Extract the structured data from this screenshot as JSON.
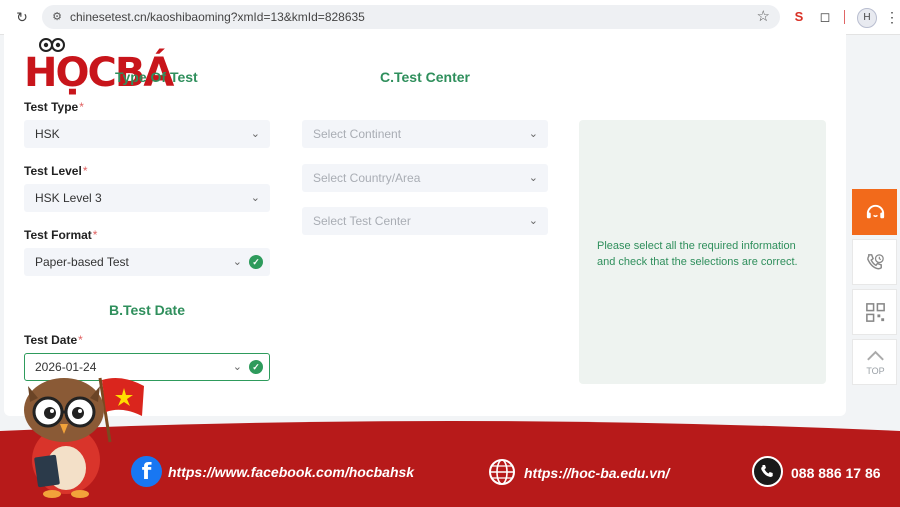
{
  "browser": {
    "url": "chinesetest.cn/kaoshibaoming?xmId=13&kmId=828635",
    "profile_initial": "H"
  },
  "logo": {
    "text": "HỌCBÁ"
  },
  "section_a": {
    "title": "Type Of Test",
    "test_type": {
      "label": "Test Type",
      "value": "HSK"
    },
    "test_level": {
      "label": "Test Level",
      "value": "HSK Level 3"
    },
    "test_format": {
      "label": "Test Format",
      "value": "Paper-based Test"
    }
  },
  "section_b": {
    "title": "B.Test Date",
    "test_date": {
      "label": "Test Date",
      "value": "2026-01-24"
    }
  },
  "section_c": {
    "title": "C.Test Center",
    "continent_placeholder": "Select Continent",
    "country_placeholder": "Select Country/Area",
    "center_placeholder": "Select Test Center",
    "info_message": "Please select all the required information and check that the selections are correct."
  },
  "required_mark": "*",
  "float_tools": {
    "top_label": "TOP"
  },
  "footer": {
    "facebook": "https://www.facebook.com/hocbahsk",
    "website": "https://hoc-ba.edu.vn/",
    "phone": "088 886 17 86"
  },
  "colors": {
    "accent_green": "#2f8f5c",
    "brand_red": "#c8151b",
    "footer_red": "#b71a1a",
    "float_orange": "#f26a1b"
  }
}
